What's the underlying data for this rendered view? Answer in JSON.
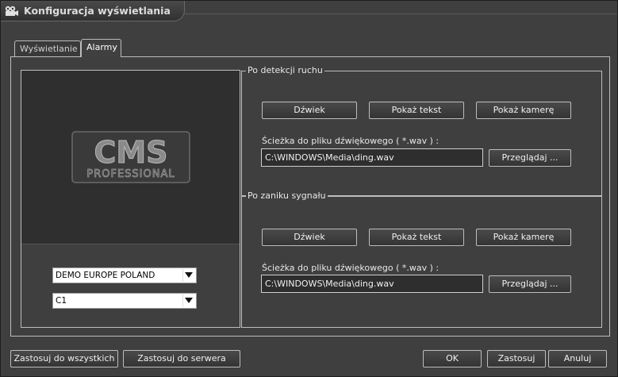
{
  "window": {
    "title": "Konfiguracja wyświetlania",
    "icon": "camera-film-icon"
  },
  "tabs": [
    {
      "label": "Wyświetlanie",
      "active": false
    },
    {
      "label": "Alarmy",
      "active": true
    }
  ],
  "preview": {
    "logo_main": "CMS",
    "logo_sub": "PROFESSIONAL"
  },
  "selectors": {
    "site": "DEMO EUROPE POLAND",
    "camera": "C1"
  },
  "groups": [
    {
      "title": "Po detekcji ruchu",
      "buttons": {
        "sound": "Dźwiek",
        "show_text": "Pokaż tekst",
        "show_camera": "Pokaż kamerę"
      },
      "path_label": "Ścieżka do pliku dźwiękowego ( *.wav ) :",
      "path_value": "C:\\WINDOWS\\Media\\ding.wav",
      "browse": "Przeglądaj ..."
    },
    {
      "title": "Po zaniku sygnału",
      "buttons": {
        "sound": "Dźwiek",
        "show_text": "Pokaż tekst",
        "show_camera": "Pokaż kamerę"
      },
      "path_label": "Ścieżka do pliku dźwiękowego ( *.wav ) :",
      "path_value": "C:\\WINDOWS\\Media\\ding.wav",
      "browse": "Przeglądaj ..."
    }
  ],
  "footer": {
    "apply_all": "Zastosuj do wszystkich",
    "apply_server": "Zastosuj do serwera",
    "ok": "OK",
    "apply": "Zastosuj",
    "cancel": "Anuluj"
  }
}
